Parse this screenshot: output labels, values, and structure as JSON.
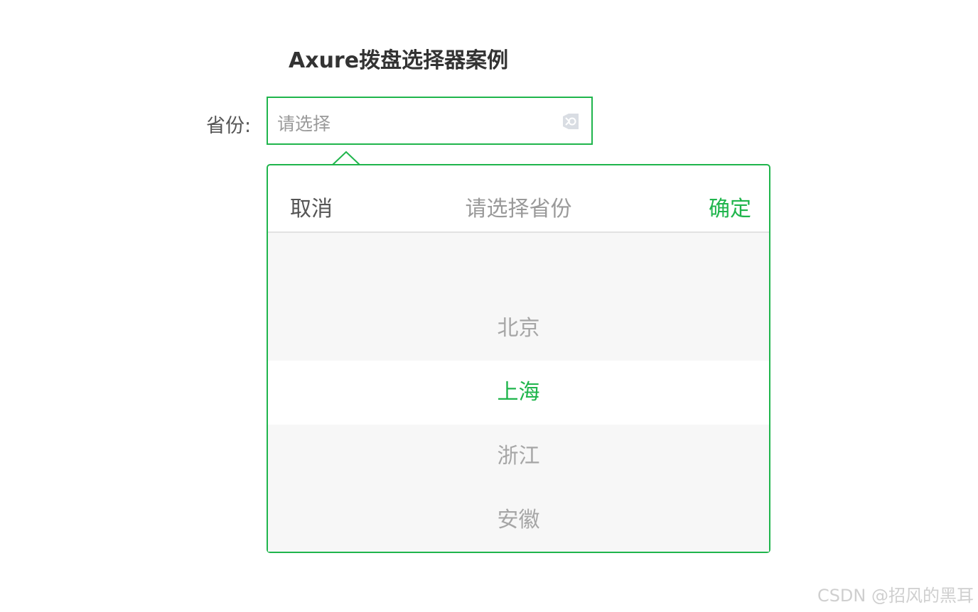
{
  "page": {
    "title": "Axure拨盘选择器案例",
    "watermark": "CSDN @招风的黑耳"
  },
  "form": {
    "province_label": "省份:",
    "province_placeholder": "请选择",
    "clear_icon": "clear-icon"
  },
  "picker": {
    "cancel_label": "取消",
    "title": "请选择省份",
    "confirm_label": "确定",
    "options": [
      "北京",
      "上海",
      "浙江",
      "安徽"
    ],
    "selected": "上海"
  },
  "colors": {
    "accent": "#1fb54c",
    "text_muted": "#a6a6a6",
    "wheel_bg": "#f7f7f7"
  }
}
